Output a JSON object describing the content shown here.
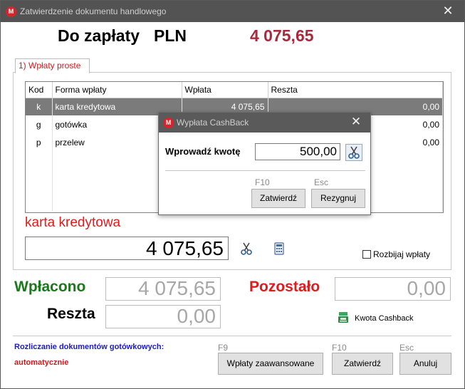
{
  "window": {
    "title": "Zatwierdzenie dokumentu handlowego",
    "close_glyph": "✕"
  },
  "summary": {
    "due_label": "Do zapłaty",
    "currency": "PLN",
    "due_amount": "4 075,65"
  },
  "tab": {
    "label": "1) Wpłaty proste"
  },
  "grid": {
    "columns": [
      "Kod",
      "Forma wpłaty",
      "Wpłata",
      "Reszta"
    ],
    "rows": [
      {
        "kod": "k",
        "forma": "karta kredytowa",
        "wplata": "4 075,65",
        "reszta": "0,00"
      },
      {
        "kod": "g",
        "forma": "gotówka",
        "wplata": "",
        "reszta": "0,00"
      },
      {
        "kod": "p",
        "forma": "przelew",
        "wplata": "",
        "reszta": "0,00"
      }
    ]
  },
  "selected_method": {
    "label": "karta kredytowa",
    "amount": "4 075,65"
  },
  "split_payments": {
    "label": "Rozbijaj wpłaty",
    "checked": false
  },
  "totals": {
    "paid_label": "Wpłacono",
    "paid_value": "4 075,65",
    "remaining_label": "Pozostało",
    "remaining_value": "0,00",
    "change_label": "Reszta",
    "change_value": "0,00"
  },
  "cashback": {
    "label": "Kwota Cashback"
  },
  "settlement": {
    "label": "Rozliczanie dokumentów gotówkowych:",
    "value": "automatycznie"
  },
  "footer": {
    "advanced": {
      "key": "F9",
      "label": "Wpłaty zaawansowane"
    },
    "confirm": {
      "key": "F10",
      "label": "Zatwierdź"
    },
    "cancel": {
      "key": "Esc",
      "label": "Anuluj"
    }
  },
  "popup": {
    "title": "Wypłata CashBack",
    "close_glyph": "✕",
    "prompt": "Wprowadź kwotę",
    "amount": "500,00",
    "confirm": {
      "key": "F10",
      "label": "Zatwierdź"
    },
    "cancel": {
      "key": "Esc",
      "label": "Rezygnuj"
    }
  },
  "colors": {
    "due_amount": "#a82a3c",
    "paid": "#1a7a1a",
    "remaining": "#e01b1b",
    "settle_label": "#1b1bc8",
    "settle_value": "#d01b1b",
    "titlebar": "#535353"
  },
  "icons": {
    "app": "app-logo-icon",
    "scissors": "scissors-icon",
    "calculator": "calculator-icon",
    "cashback": "cash-register-icon"
  },
  "app_logo_letter": "M"
}
